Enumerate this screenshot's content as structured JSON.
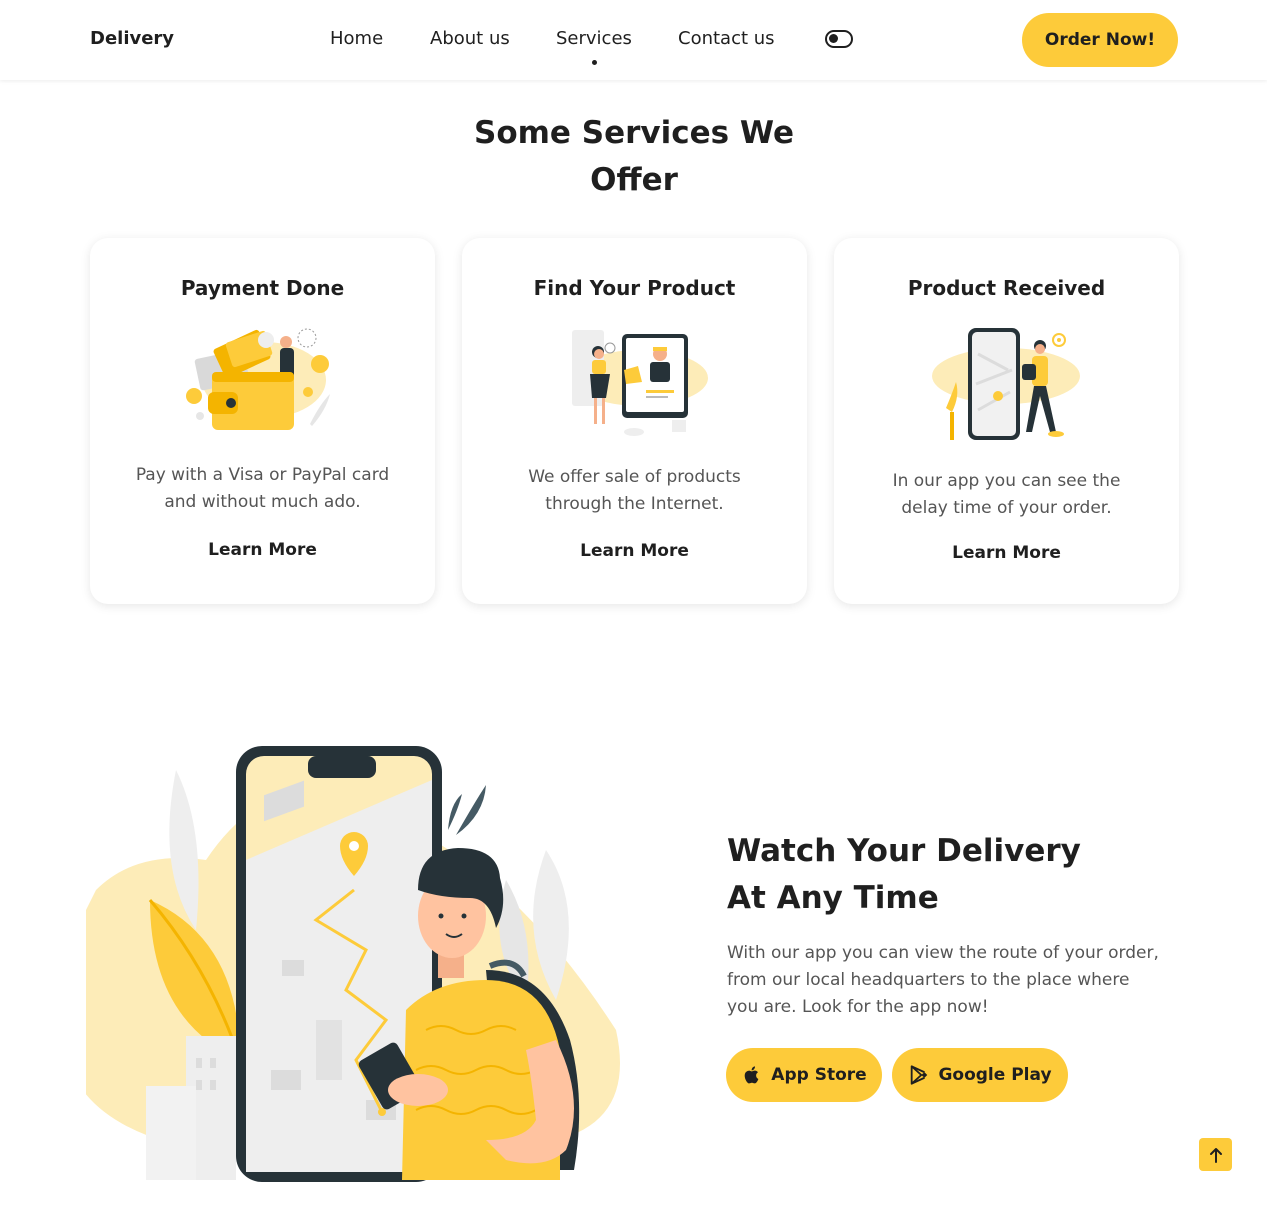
{
  "header": {
    "logo": "Delivery",
    "nav": [
      {
        "label": "Home"
      },
      {
        "label": "About us"
      },
      {
        "label": "Services"
      },
      {
        "label": "Contact us"
      }
    ],
    "active_nav": "Services",
    "order_button": "Order Now!"
  },
  "services": {
    "title_line1": "Some Services We",
    "title_line2": "Offer",
    "cards": [
      {
        "title": "Payment Done",
        "desc_line1": "Pay with a Visa or PayPal card",
        "desc_line2": "and without much ado.",
        "link": "Learn More",
        "icon": "wallet-payment-illustration"
      },
      {
        "title": "Find Your Product",
        "desc_line1": "We offer sale of products",
        "desc_line2": "through the Internet.",
        "link": "Learn More",
        "icon": "online-shopping-illustration"
      },
      {
        "title": "Product Received",
        "desc_line1": "In our app you can see the",
        "desc_line2": "delay time of your order.",
        "link": "Learn More",
        "icon": "phone-delivery-illustration"
      }
    ]
  },
  "app": {
    "title_line1": "Watch Your Delivery",
    "title_line2": "At Any Time",
    "desc_line1": "With our app you can view the route of your order,",
    "desc_line2": "from our local headquarters to the place where",
    "desc_line3": "you are. Look for the app now!",
    "app_store": "App Store",
    "google_play": "Google Play"
  },
  "colors": {
    "accent": "#fdcb3a",
    "text": "#1f1f1f",
    "muted": "#555555",
    "dark_ink": "#263238"
  }
}
